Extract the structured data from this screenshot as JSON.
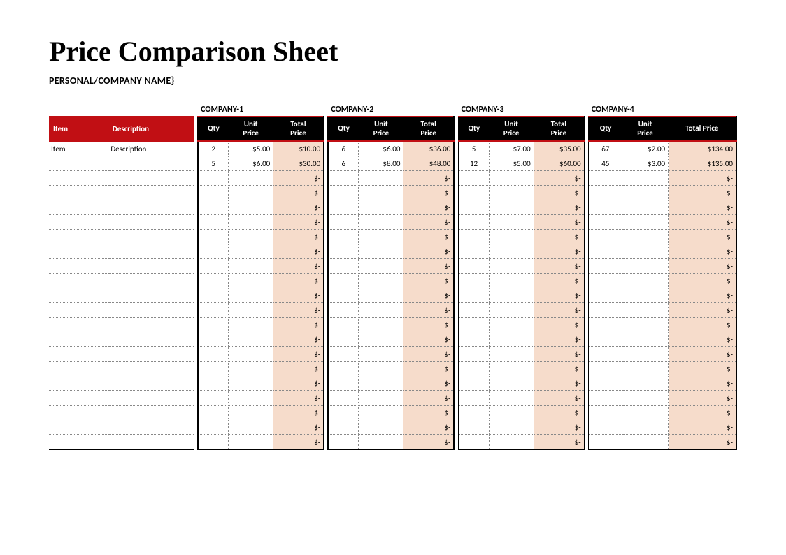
{
  "title": "Price Comparison Sheet",
  "subtitle": "PERSONAL/COMPANY NAME}",
  "itemHeader": {
    "item": "Item",
    "desc": "Description"
  },
  "companyHeaders": [
    "COMPANY-1",
    "COMPANY-2",
    "COMPANY-3",
    "COMPANY-4"
  ],
  "colHeaders": {
    "qty": "Qty",
    "unit": "Unit Price",
    "total": "Total Price"
  },
  "emptyTotal": "$-",
  "totalRows": 21,
  "rows": [
    {
      "item": "Item",
      "desc": "Description",
      "c1": {
        "qty": "2",
        "unit": "$5.00",
        "total": "$10.00"
      },
      "c2": {
        "qty": "6",
        "unit": "$6.00",
        "total": "$36.00"
      },
      "c3": {
        "qty": "5",
        "unit": "$7.00",
        "total": "$35.00"
      },
      "c4": {
        "qty": "67",
        "unit": "$2.00",
        "total": "$134.00"
      }
    },
    {
      "item": "",
      "desc": "",
      "c1": {
        "qty": "5",
        "unit": "$6.00",
        "total": "$30.00"
      },
      "c2": {
        "qty": "6",
        "unit": "$8.00",
        "total": "$48.00"
      },
      "c3": {
        "qty": "12",
        "unit": "$5.00",
        "total": "$60.00"
      },
      "c4": {
        "qty": "45",
        "unit": "$3.00",
        "total": "$135.00"
      }
    }
  ]
}
